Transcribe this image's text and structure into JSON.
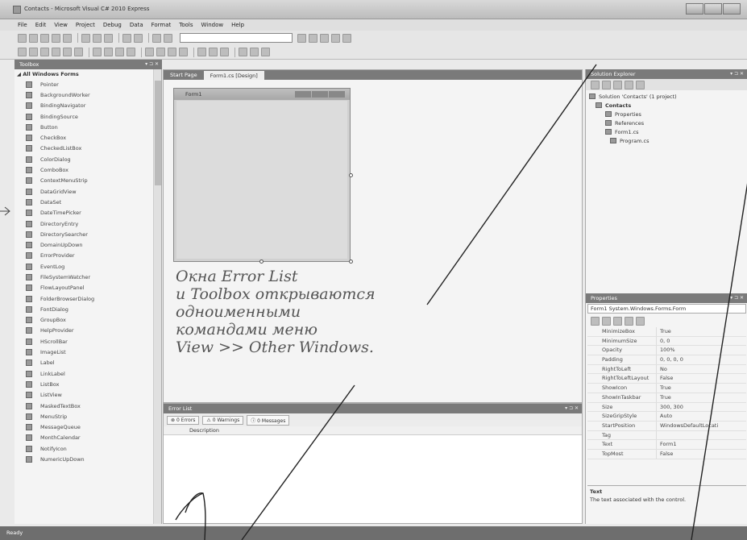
{
  "window": {
    "title": "Contacts - Microsoft Visual C# 2010 Express"
  },
  "menu": [
    "File",
    "Edit",
    "View",
    "Project",
    "Debug",
    "Data",
    "Format",
    "Tools",
    "Window",
    "Help"
  ],
  "toolbox": {
    "title": "Toolbox",
    "group": "◢ All Windows Forms",
    "items": [
      "Pointer",
      "BackgroundWorker",
      "BindingNavigator",
      "BindingSource",
      "Button",
      "CheckBox",
      "CheckedListBox",
      "ColorDialog",
      "ComboBox",
      "ContextMenuStrip",
      "DataGridView",
      "DataSet",
      "DateTimePicker",
      "DirectoryEntry",
      "DirectorySearcher",
      "DomainUpDown",
      "ErrorProvider",
      "EventLog",
      "FileSystemWatcher",
      "FlowLayoutPanel",
      "FolderBrowserDialog",
      "FontDialog",
      "GroupBox",
      "HelpProvider",
      "HScrollBar",
      "ImageList",
      "Label",
      "LinkLabel",
      "ListBox",
      "ListView",
      "MaskedTextBox",
      "MenuStrip",
      "MessageQueue",
      "MonthCalendar",
      "NotifyIcon",
      "NumericUpDown"
    ]
  },
  "editor": {
    "tabs": [
      "Start Page",
      "Form1.cs [Design]"
    ],
    "form_caption": "Form1"
  },
  "annotation": [
    "Окна Error List",
    "и Toolbox открываются",
    "одноименными",
    "командами меню",
    "View >> Other Windows."
  ],
  "error_list": {
    "title": "Error List",
    "buttons": [
      "0 Errors",
      "0 Warnings",
      "0 Messages"
    ],
    "column": "Description"
  },
  "solution_explorer": {
    "title": "Solution Explorer",
    "nodes": [
      "Solution 'Contacts' (1 project)",
      "Contacts",
      "Properties",
      "References",
      "Form1.cs",
      "Program.cs"
    ]
  },
  "properties": {
    "title": "Properties",
    "object": "Form1 System.Windows.Forms.Form",
    "rows": [
      {
        "name": "MinimizeBox",
        "value": "True"
      },
      {
        "name": "MinimumSize",
        "value": "0, 0"
      },
      {
        "name": "Opacity",
        "value": "100%"
      },
      {
        "name": "Padding",
        "value": "0, 0, 0, 0"
      },
      {
        "name": "RightToLeft",
        "value": "No"
      },
      {
        "name": "RightToLeftLayout",
        "value": "False"
      },
      {
        "name": "ShowIcon",
        "value": "True"
      },
      {
        "name": "ShowInTaskbar",
        "value": "True"
      },
      {
        "name": "Size",
        "value": "300, 300"
      },
      {
        "name": "SizeGripStyle",
        "value": "Auto"
      },
      {
        "name": "StartPosition",
        "value": "WindowsDefaultLocati"
      },
      {
        "name": "Tag",
        "value": ""
      },
      {
        "name": "Text",
        "value": "Form1"
      },
      {
        "name": "TopMost",
        "value": "False"
      }
    ],
    "desc_title": "Text",
    "desc_text": "The text associated with the control."
  },
  "status": "Ready"
}
